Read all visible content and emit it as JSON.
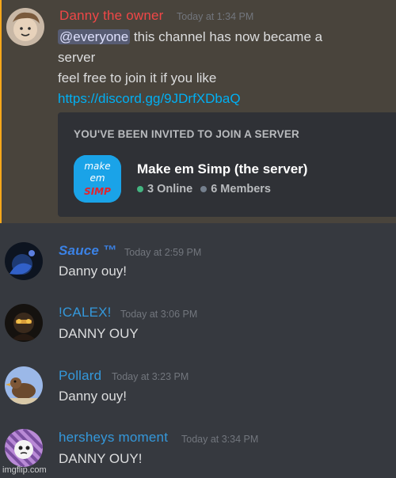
{
  "messages": [
    {
      "author": "Danny the owner",
      "author_color": "#f04747",
      "timestamp": "Today at 1:34 PM",
      "mention": "@everyone",
      "lines": [
        " this channel has now became a",
        "server",
        "feel free to join it if you like"
      ],
      "link": "https://discord.gg/9JDrfXDbaQ",
      "invite": {
        "header": "YOU'VE BEEN INVITED TO JOIN A SERVER",
        "server_name": "Make em Simp (the server)",
        "icon_text": [
          "make",
          "em",
          "SIMP"
        ],
        "online": "3 Online",
        "members": "6 Members"
      }
    },
    {
      "author": "Sauce ™",
      "author_color": "#3b82e6",
      "timestamp": "Today at 2:59 PM",
      "text": "Danny ouy!"
    },
    {
      "author": "!CALEX!",
      "author_color": "#3498db",
      "timestamp": "Today at 3:06 PM",
      "text": "DANNY OUY"
    },
    {
      "author": "Pollard",
      "author_color": "#3498db",
      "timestamp": "Today at 3:23 PM",
      "text": "Danny ouy!"
    },
    {
      "author": "hersheys moment",
      "author_color": "#3498db",
      "timestamp": "Today at 3:34 PM",
      "text": "DANNY OUY!"
    }
  ],
  "watermark": "imgflip.com"
}
